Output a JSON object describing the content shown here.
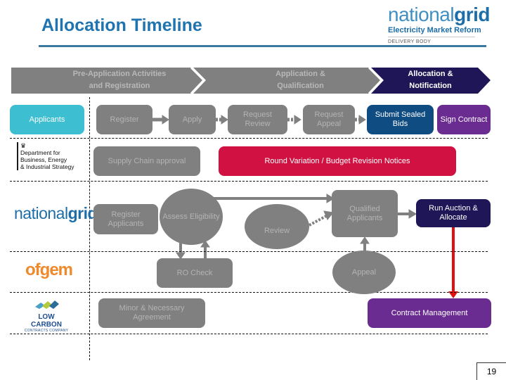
{
  "header": {
    "title": "Allocation Timeline",
    "brand_name_light": "national",
    "brand_name_bold": "grid",
    "brand_subtitle": "Electricity Market Reform",
    "brand_tagline": "DELIVERY BODY"
  },
  "phases": [
    {
      "line1": "Pre-Application Activities",
      "line2": "and Registration",
      "color": "#808080",
      "text_color": "#b8b8b8"
    },
    {
      "line1": "Application &",
      "line2": "Qualification",
      "color": "#808080",
      "text_color": "#b8b8b8"
    },
    {
      "line1": "Allocation &",
      "line2": "Notification",
      "color": "#1e1656",
      "text_color": "#ffffff"
    }
  ],
  "lanes": {
    "applicants": {
      "label": "Applicants"
    },
    "beis": {
      "line1": "Department for",
      "line2": "Business, Energy",
      "line3": "& Industrial Strategy",
      "icon": "crest-icon"
    },
    "national_grid": {
      "light": "national",
      "bold": "grid"
    },
    "ofgem": {
      "label": "ofgem"
    },
    "lccc": {
      "line1": "LOW CARBON",
      "line2": "CONTRACTS COMPANY"
    }
  },
  "steps": {
    "register": "Register",
    "apply": "Apply",
    "request_review": "Request Review",
    "request_appeal": "Request Appeal",
    "submit_sealed_bids": "Submit Sealed Bids",
    "sign_contract": "Sign Contract",
    "supply_chain_approval": "Supply Chain approval",
    "round_variation": "Round Variation / Budget Revision Notices",
    "register_applicants": "Register Applicants",
    "assess_eligibility": "Assess Eligibility",
    "review": "Review",
    "qualified_applicants": "Qualified Applicants",
    "run_auction": "Run Auction & Allocate",
    "ro_check": "RO Check",
    "appeal": "Appeal",
    "minor_necessary": "Minor & Necessary Agreement",
    "contract_management": "Contract Management"
  },
  "colors": {
    "title_blue": "#1f74b0",
    "applicants_cyan": "#3dbfd1",
    "inactive_grey": "#808080",
    "navy": "#1e1656",
    "dark_blue": "#0f4c81",
    "purple": "#6a2c91",
    "crimson": "#d01141",
    "red_arrow": "#e01010"
  },
  "page_number": "19"
}
